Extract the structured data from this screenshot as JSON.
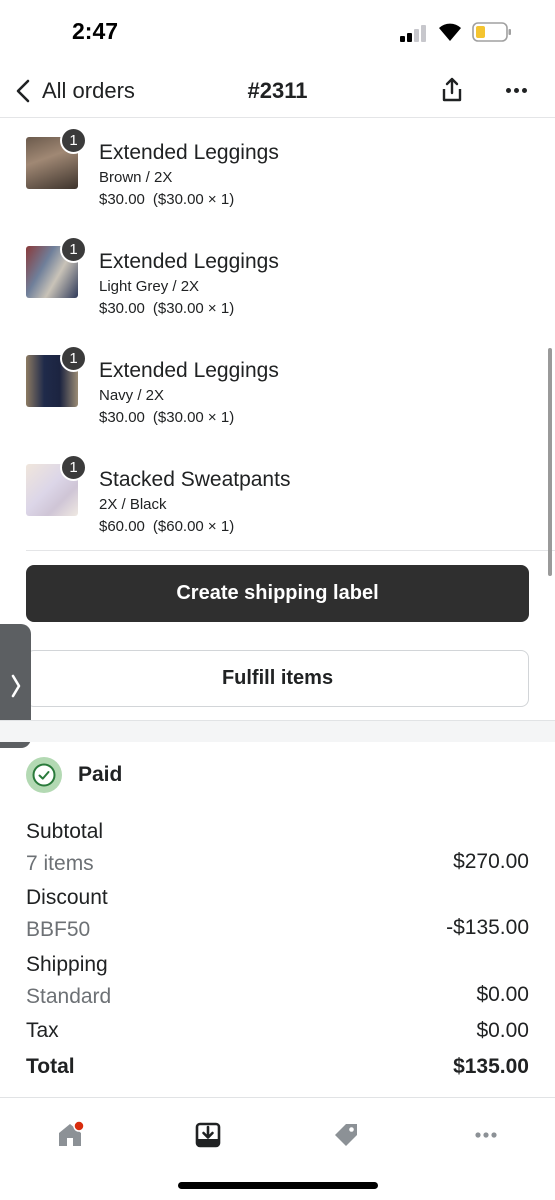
{
  "status_bar": {
    "time": "2:47"
  },
  "nav": {
    "back_label": "All orders",
    "title": "#2311"
  },
  "line_items": [
    {
      "quantity": "1",
      "title": "Extended Leggings",
      "variant": "Brown / 2X",
      "price": "$30.00",
      "unit_detail": "($30.00 × 1)"
    },
    {
      "quantity": "1",
      "title": "Extended Leggings",
      "variant": "Light Grey / 2X",
      "price": "$30.00",
      "unit_detail": "($30.00 × 1)"
    },
    {
      "quantity": "1",
      "title": "Extended Leggings",
      "variant": "Navy / 2X",
      "price": "$30.00",
      "unit_detail": "($30.00 × 1)"
    },
    {
      "quantity": "1",
      "title": "Stacked Sweatpants",
      "variant": "2X / Black",
      "price": "$60.00",
      "unit_detail": "($60.00 × 1)"
    }
  ],
  "actions": {
    "create_label": "Create shipping label",
    "fulfill": "Fulfill items"
  },
  "payment": {
    "status": "Paid",
    "subtotal": {
      "label": "Subtotal",
      "sub": "7 items",
      "value": "$270.00"
    },
    "discount": {
      "label": "Discount",
      "sub": "BBF50",
      "value": "-$135.00"
    },
    "shipping": {
      "label": "Shipping",
      "sub": "Standard",
      "value": "$0.00"
    },
    "tax": {
      "label": "Tax",
      "value": "$0.00"
    },
    "total": {
      "label": "Total",
      "value": "$135.00"
    }
  },
  "tabs": [
    {
      "name": "home-icon"
    },
    {
      "name": "orders-icon"
    },
    {
      "name": "products-icon"
    },
    {
      "name": "more-icon"
    }
  ],
  "colors": {
    "dark_button": "#2f2f2f",
    "paid_badge": "#b3d9b3",
    "notification": "#d82c0d"
  }
}
